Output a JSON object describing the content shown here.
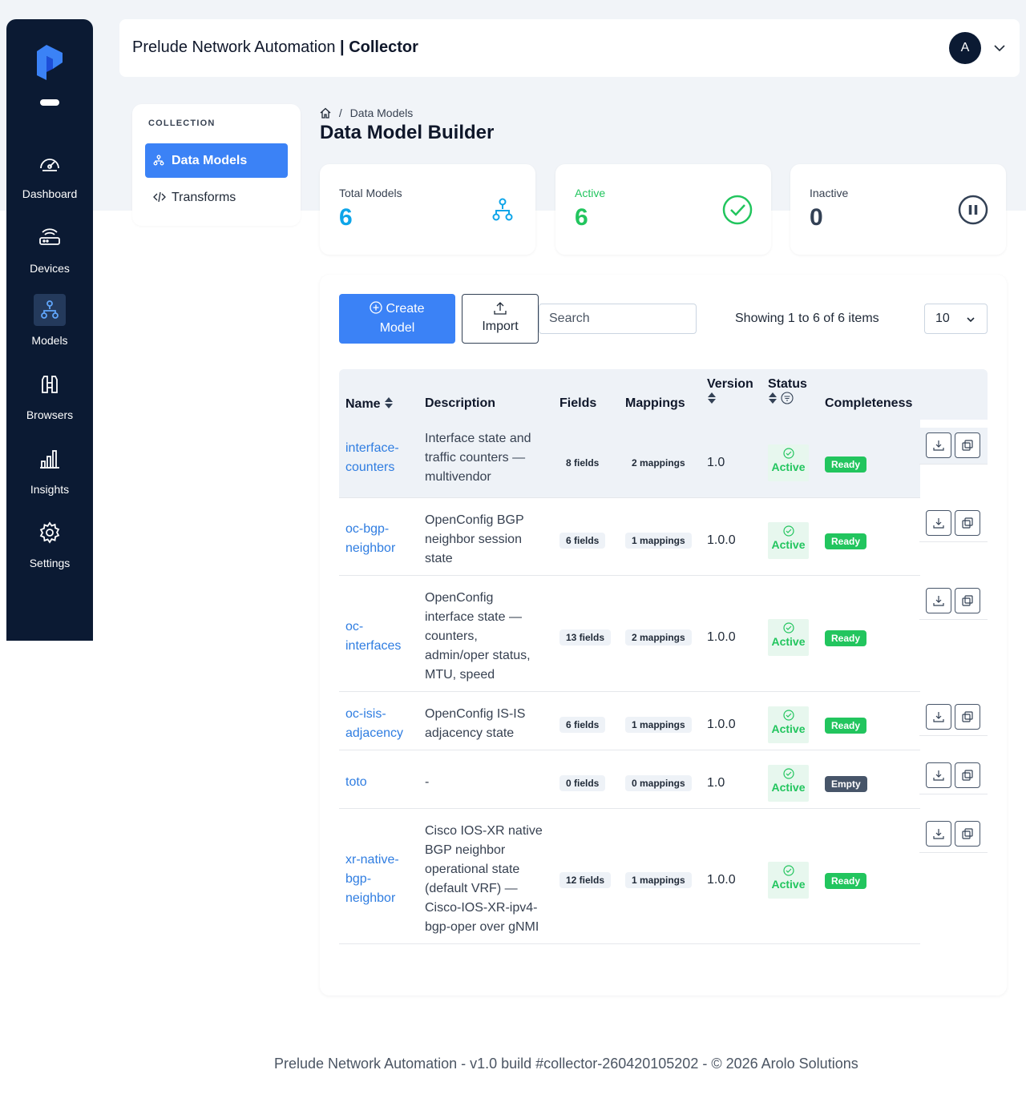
{
  "app": {
    "title_prefix": "Prelude Network Automation",
    "title_sep": " | ",
    "title_section": "Collector",
    "avatar_initial": "A"
  },
  "rail": {
    "items": [
      {
        "label": "Dashboard",
        "icon": "gauge-icon"
      },
      {
        "label": "Devices",
        "icon": "router-icon"
      },
      {
        "label": "Models",
        "icon": "hierarchy-icon",
        "active": true
      },
      {
        "label": "Browsers",
        "icon": "binoculars-icon"
      },
      {
        "label": "Insights",
        "icon": "bar-chart-icon"
      },
      {
        "label": "Settings",
        "icon": "gear-icon"
      }
    ]
  },
  "subnav": {
    "section_label": "COLLECTION",
    "items": [
      {
        "label": "Data Models",
        "icon": "hierarchy-icon",
        "active": true
      },
      {
        "label": "Transforms",
        "icon": "code-icon"
      }
    ]
  },
  "breadcrumb": {
    "home_icon": "home-icon",
    "separator": "/",
    "current": "Data Models"
  },
  "page_title": "Data Model Builder",
  "stats": [
    {
      "label": "Total Models",
      "value": "6",
      "color": "#0ea5e9",
      "icon": "hierarchy-icon"
    },
    {
      "label": "Active",
      "value": "6",
      "color": "#22c55e",
      "icon": "check-circle-icon"
    },
    {
      "label": "Inactive",
      "value": "0",
      "color": "#334155",
      "icon": "pause-circle-icon"
    }
  ],
  "toolbar": {
    "create_line1": "Create",
    "create_line2": "Model",
    "import_label": "Import",
    "search_placeholder": "Search",
    "showing": "Showing 1 to 6 of 6 items",
    "page_size": "10"
  },
  "table": {
    "headers": {
      "name": "Name",
      "description": "Description",
      "fields": "Fields",
      "mappings": "Mappings",
      "version": "Version",
      "status": "Status",
      "completeness": "Completeness"
    },
    "rows": [
      {
        "name_lines": [
          "interface-",
          "counters"
        ],
        "desc_lines": [
          "Interface state and",
          "traffic counters —",
          "multivendor"
        ],
        "fields": "8 fields",
        "mappings": "2 mappings",
        "version": "1.0",
        "status": "Active",
        "completeness": "Ready"
      },
      {
        "name_lines": [
          "oc-bgp-",
          "neighbor"
        ],
        "desc_lines": [
          "OpenConfig BGP",
          "neighbor session",
          "state"
        ],
        "fields": "6 fields",
        "mappings": "1 mappings",
        "version": "1.0.0",
        "status": "Active",
        "completeness": "Ready"
      },
      {
        "name_lines": [
          "oc-",
          "interfaces"
        ],
        "desc_lines": [
          "OpenConfig",
          "interface state —",
          "counters,",
          "admin/oper status,",
          "MTU, speed"
        ],
        "fields": "13 fields",
        "mappings": "2 mappings",
        "version": "1.0.0",
        "status": "Active",
        "completeness": "Ready"
      },
      {
        "name_lines": [
          "oc-isis-",
          "adjacency"
        ],
        "desc_lines": [
          "OpenConfig IS-IS",
          "adjacency state"
        ],
        "fields": "6 fields",
        "mappings": "1 mappings",
        "version": "1.0.0",
        "status": "Active",
        "completeness": "Ready"
      },
      {
        "name_lines": [
          "toto"
        ],
        "desc_lines": [
          "-"
        ],
        "fields": "0 fields",
        "mappings": "0 mappings",
        "version": "1.0",
        "status": "Active",
        "completeness": "Empty"
      },
      {
        "name_lines": [
          "xr-native-",
          "bgp-",
          "neighbor"
        ],
        "desc_lines": [
          "Cisco IOS-XR native",
          "BGP neighbor",
          "operational state",
          "(default VRF) —",
          "Cisco-IOS-XR-ipv4-",
          "bgp-oper over gNMI"
        ],
        "fields": "12 fields",
        "mappings": "1 mappings",
        "version": "1.0.0",
        "status": "Active",
        "completeness": "Ready"
      }
    ]
  },
  "footer": "Prelude Network Automation - v1.0 build #collector-260420105202 - © 2026 Arolo Solutions"
}
